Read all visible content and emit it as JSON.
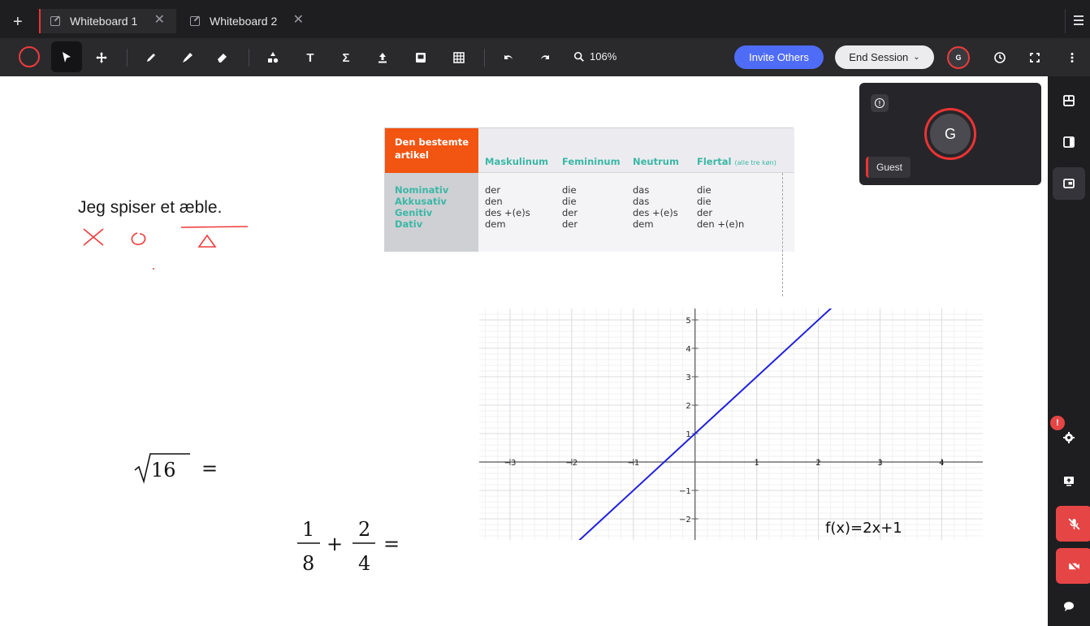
{
  "tabs": [
    {
      "label": "Whiteboard 1",
      "active": true
    },
    {
      "label": "Whiteboard 2",
      "active": false
    }
  ],
  "toolbar": {
    "zoom": "106%",
    "invite_label": "Invite Others",
    "end_session_label": "End Session",
    "avatar_initial": "G",
    "accent_color": "#4f6cf7",
    "pen_color": "#ef3b3b"
  },
  "video_panel": {
    "avatar_initial": "G",
    "name": "Guest"
  },
  "sidebar": {
    "notification_badge": "!"
  },
  "canvas": {
    "sentence": "Jeg spiser et æble.",
    "grammar_table": {
      "header": [
        "Den bestemte",
        "artikel"
      ],
      "columns": [
        "Maskulinum",
        "Femininum",
        "Neutrum",
        "Flertal"
      ],
      "flertal_note": "(alle tre køn)",
      "rows": [
        {
          "label": "Nominativ",
          "cells": [
            "der",
            "die",
            "das",
            "die"
          ]
        },
        {
          "label": "Akkusativ",
          "cells": [
            "den",
            "die",
            "das",
            "die"
          ]
        },
        {
          "label": "Genitiv",
          "cells": [
            "des +(e)s",
            "der",
            "des +(e)s",
            "der"
          ]
        },
        {
          "label": "Dativ",
          "cells": [
            "dem",
            "der",
            "dem",
            "den +(e)n"
          ]
        }
      ]
    },
    "sqrt_expr": {
      "radicand": "16",
      "suffix": "="
    },
    "fraction_expr": {
      "a_num": "1",
      "a_den": "8",
      "op": "+",
      "b_num": "2",
      "b_den": "4",
      "suffix": "="
    },
    "function_label": "f(x)=2x+1"
  },
  "chart_data": {
    "type": "line",
    "title": "",
    "xlabel": "",
    "ylabel": "",
    "xlim": [
      -3.5,
      4.6
    ],
    "ylim": [
      -2.6,
      5.4
    ],
    "x_ticks": [
      -3,
      -2,
      -1,
      1,
      2,
      3,
      4
    ],
    "y_ticks": [
      -2,
      -1,
      1,
      2,
      3,
      4,
      5
    ],
    "grid": true,
    "series": [
      {
        "x": [
          -2.1,
          2.4
        ],
        "y": [
          -3.2,
          5.8
        ],
        "color": "#1f1fe0"
      }
    ]
  }
}
